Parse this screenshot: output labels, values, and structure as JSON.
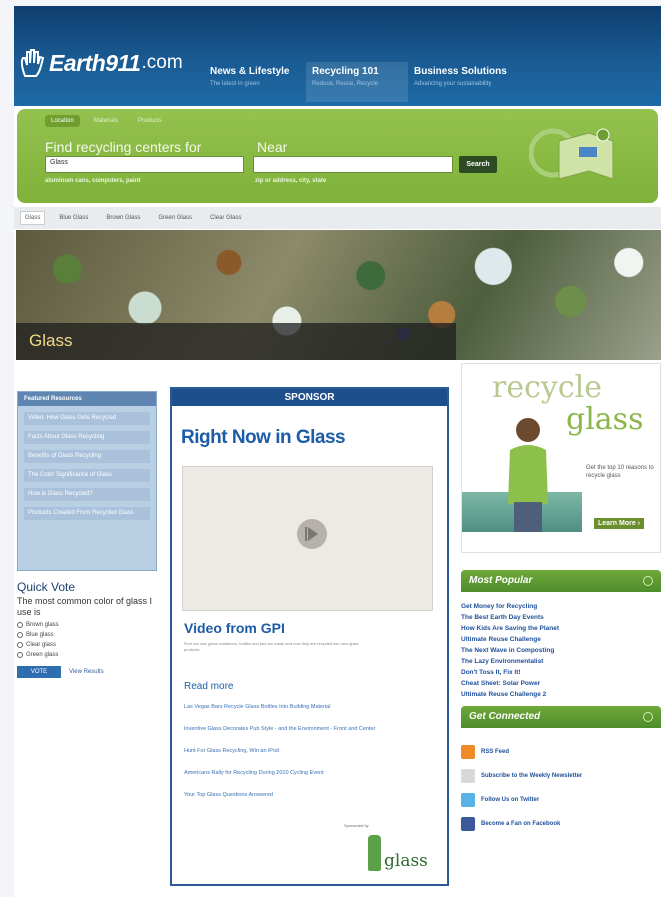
{
  "header": {
    "logo_name": "Earth911",
    "logo_domain": ".com",
    "nav": [
      {
        "label": "News & Lifestyle",
        "sub": "The latest in green"
      },
      {
        "label": "Recycling 101",
        "sub": "Reduce, Reuse, Recycle"
      },
      {
        "label": "Business Solutions",
        "sub": "Advancing your sustainability"
      }
    ]
  },
  "search": {
    "tabs": [
      "Location",
      "Materials",
      "Products"
    ],
    "find_label": "Find recycling centers for",
    "near_label": "Near",
    "what_value": "Glass",
    "near_placeholder": "",
    "button": "Search",
    "hint_what": "aluminum cans, computers, paint",
    "hint_near": "zip or address, city, state"
  },
  "crumbs": [
    "Glass",
    "Blue Glass",
    "Brown Glass",
    "Green Glass",
    "Clear Glass"
  ],
  "hero": {
    "title": "Glass"
  },
  "left": {
    "res_title": "Featured Resources",
    "resources": [
      "Video: How Glass Gets Recycled",
      "Facts About Glass Recycling",
      "Benefits of Glass Recycling",
      "The Color Significance of Glass",
      "How is Glass Recycled?",
      "Products Created From Recycled Glass"
    ],
    "quick_vote": {
      "title": "Quick Vote",
      "question": "The most common color of glass I use is",
      "options": [
        "Brown glass",
        "Blue glass",
        "Clear glass",
        "Green glass"
      ],
      "vote_label": "VOTE",
      "view_results": "View Results"
    }
  },
  "sponsor": {
    "head": "SPONSOR",
    "title": "Right Now in Glass",
    "video_title": "Video from GPI",
    "video_desc": "Find out how glass containers, bottles and jars are made and how they are recycled into new glass products.",
    "read_more": "Read more",
    "links": [
      "Las Vegas Bars Recycle Glass Bottles Into Building Material",
      "Inventive Glass Decorates Pub Style - and the Environment - Front and Center",
      "Hunt For Glass Recycling, Win an iPod",
      "Americans Rally for Recycling During 2010 Cycling Event",
      "Your Top Glass Questions Answered"
    ],
    "sponsored_by": "Sponsored by",
    "logo_text": "glass"
  },
  "right": {
    "ad": {
      "word1": "recycle",
      "word2": "glass",
      "text": "Get the top 10 reasons to recycle glass",
      "more": "Learn More ›"
    },
    "popular_title": "Most Popular",
    "popular": [
      "Get Money for Recycling",
      "The Best Earth Day Events",
      "How Kids Are Saving the Planet",
      "Ultimate Reuse Challenge",
      "The Next Wave in Composting",
      "The Lazy Environmentalist",
      "Don't Toss It, Fix It!",
      "Cheat Sheet: Solar Power",
      "Ultimate Reuse Challenge 2"
    ],
    "connect_title": "Get Connected",
    "connect": [
      {
        "icon": "rss-icon",
        "label": "RSS Feed"
      },
      {
        "icon": "mail-icon",
        "label": "Subscribe to the Weekly Newsletter"
      },
      {
        "icon": "twitter-icon",
        "label": "Follow Us on Twitter"
      },
      {
        "icon": "facebook-icon",
        "label": "Become a Fan on Facebook"
      }
    ]
  },
  "colors": {
    "header_blue": "#1a5b93",
    "search_green": "#8bbd47",
    "link_blue": "#1d5ca7"
  }
}
